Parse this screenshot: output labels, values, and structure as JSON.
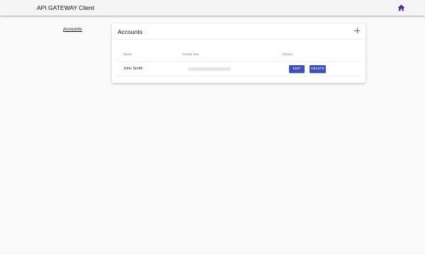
{
  "header": {
    "title": "API GATEWAY Client",
    "home_icon": "home-icon",
    "home_icon_color": "#5b2a91"
  },
  "sidebar": {
    "items": [
      {
        "label": "Accounts"
      }
    ]
  },
  "accounts_card": {
    "title": "Accounts",
    "add_icon": "plus-icon",
    "columns": [
      "Name",
      "Access Key",
      "Actions"
    ],
    "rows": [
      {
        "name": "John Smith",
        "access_key": "",
        "edit_label": "EDIT",
        "delete_label": "DELETE"
      }
    ]
  },
  "colors": {
    "primary_button": "#3f51b5",
    "topbar_bg": "#f5f5f5",
    "page_bg": "#fafafa"
  }
}
